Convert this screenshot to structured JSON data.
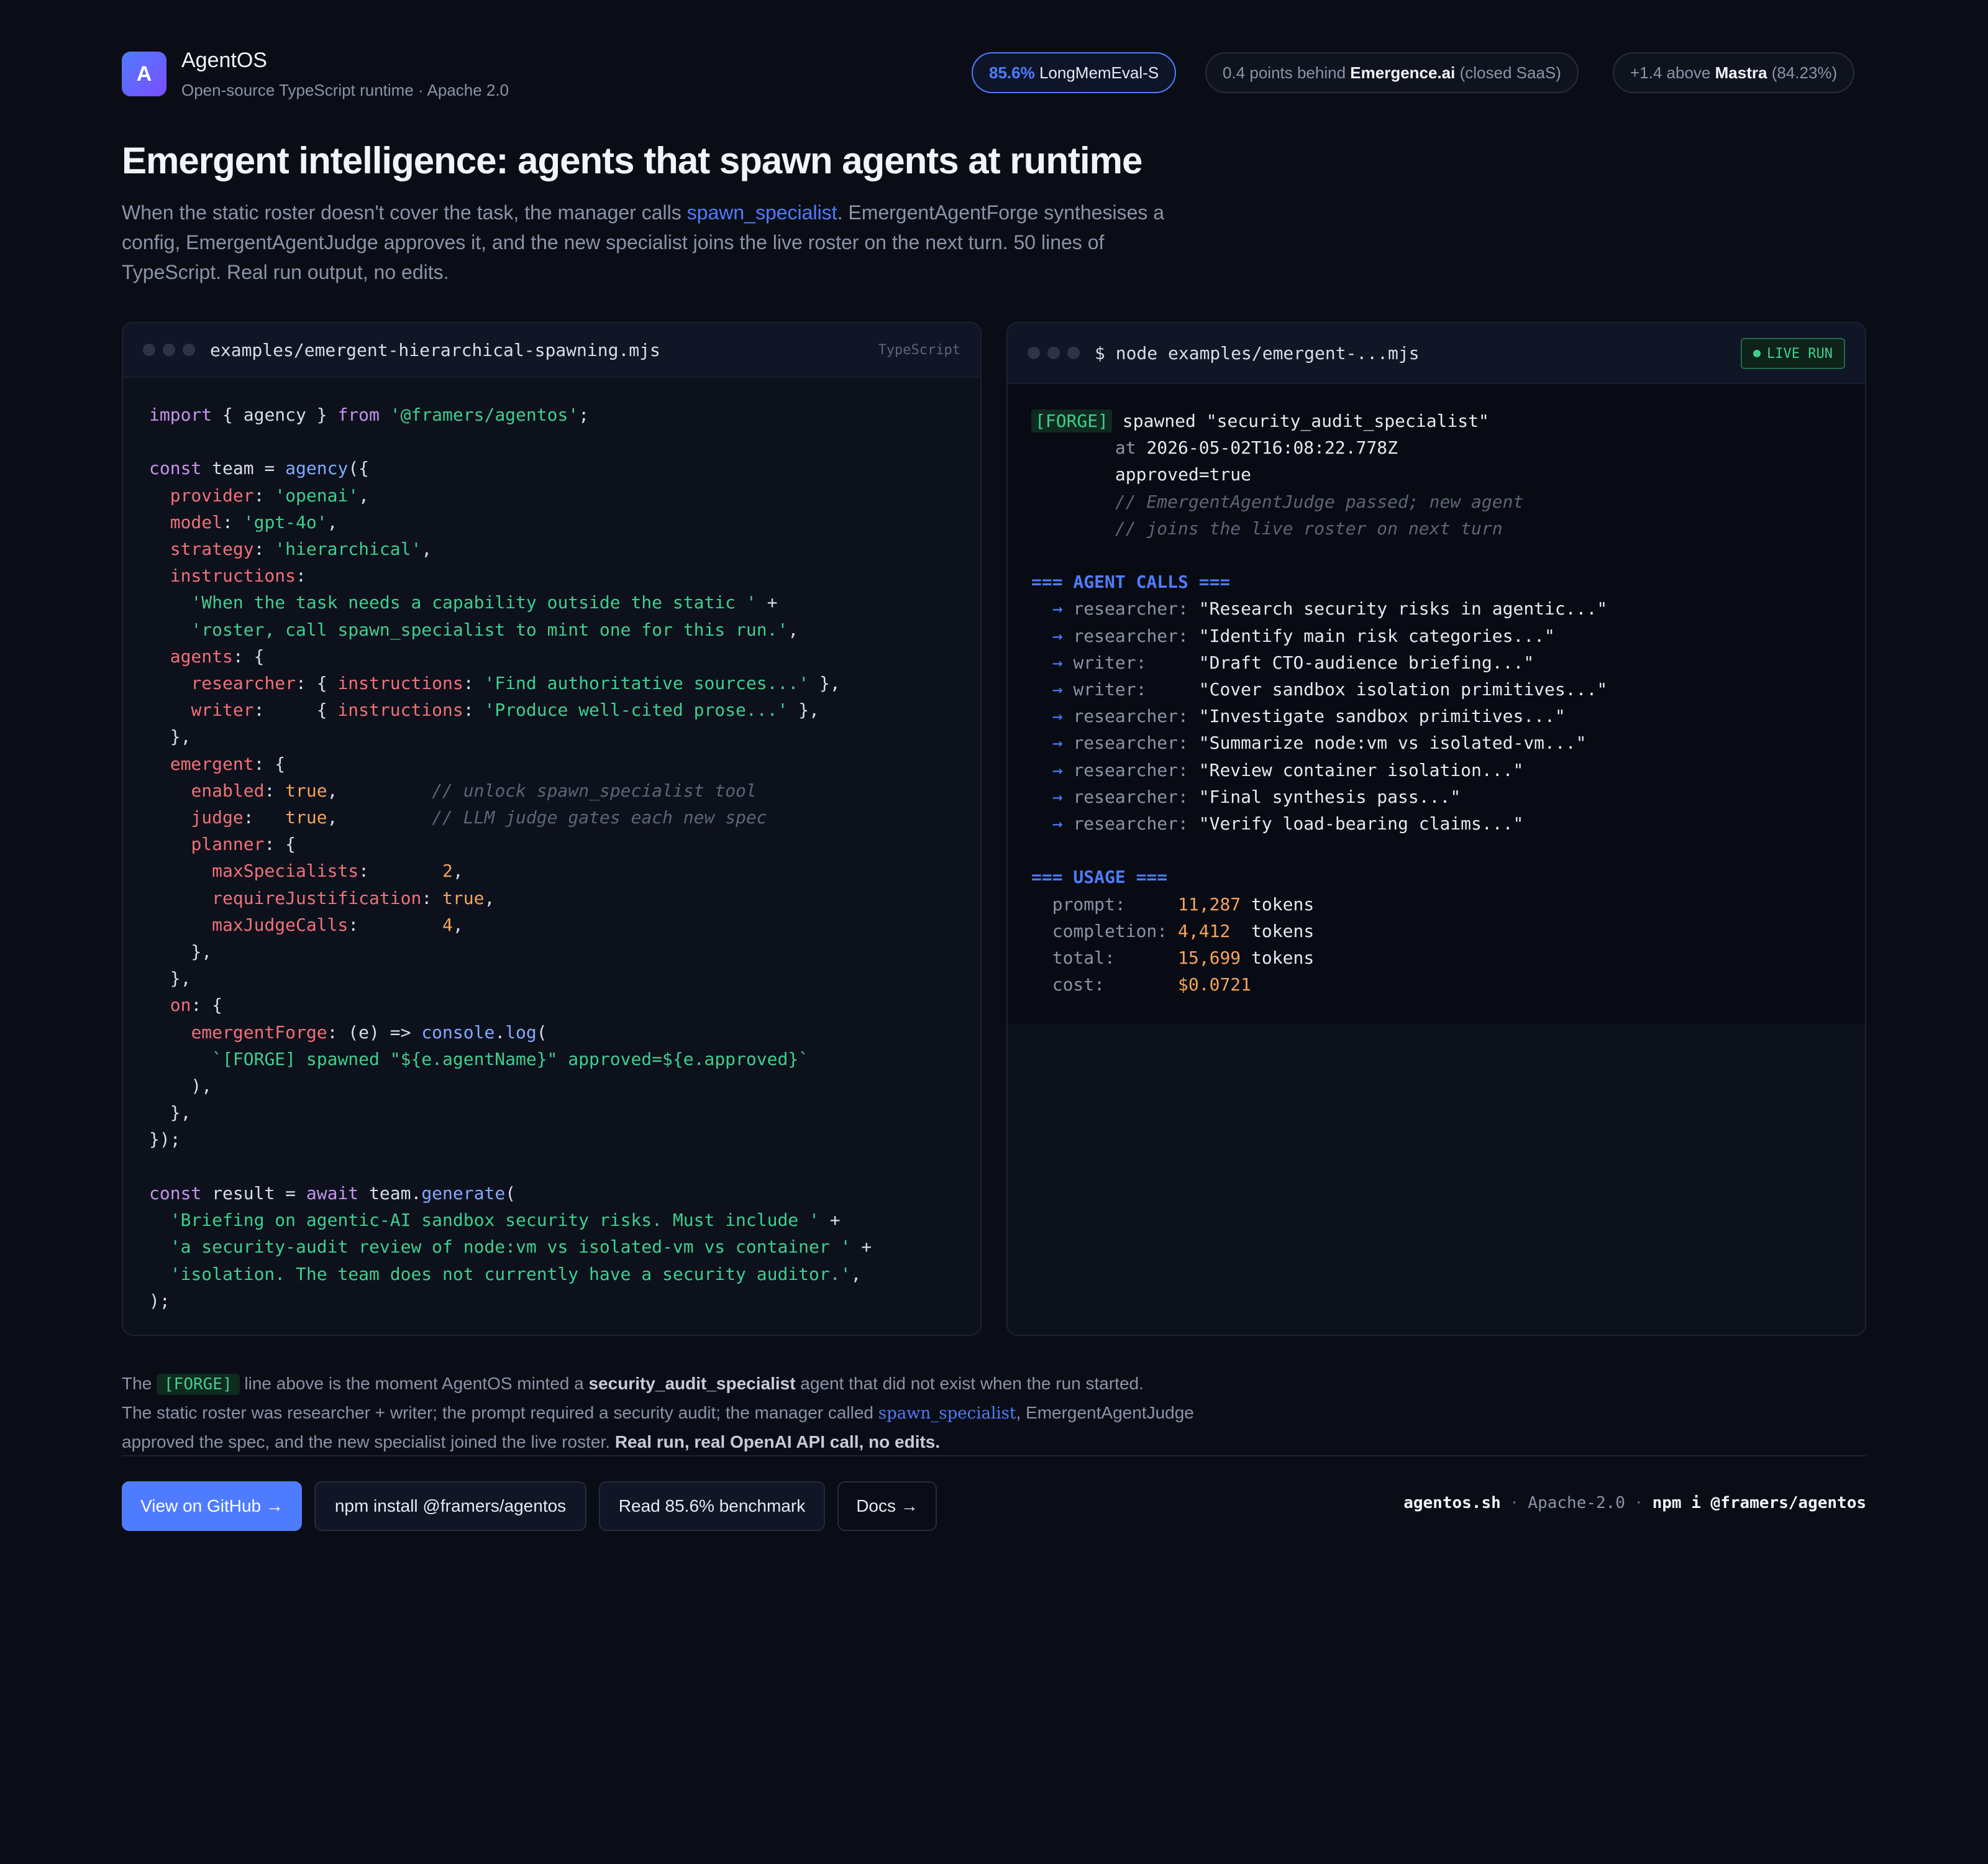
{
  "brand": {
    "logo_letter": "A",
    "name": "AgentOS",
    "subtitle": "Open-source TypeScript runtime · Apache 2.0"
  },
  "badges": {
    "score_value": "85.6%",
    "score_label": "LongMemEval-S",
    "behind_prefix": "0.4 points behind",
    "behind_name": "Emergence.ai",
    "behind_suffix": "(closed SaaS)",
    "above_prefix": "+1.4 above",
    "above_name": "Mastra",
    "above_suffix": "(84.23%)"
  },
  "hero": {
    "title": "Emergent intelligence: agents that spawn agents at runtime",
    "lede_before": "When the static roster doesn't cover the task, the manager calls ",
    "lede_link": "spawn_specialist",
    "lede_after": ". EmergentAgentForge synthesises a config, EmergentAgentJudge approves it, and the new specialist joins the live roster on the next turn. 50 lines of TypeScript. Real run output, no edits."
  },
  "code_panel": {
    "filename": "examples/emergent-hierarchical-spawning.mjs",
    "language": "TypeScript"
  },
  "terminal_panel": {
    "command": "$ node examples/emergent-...mjs",
    "live_label": "LIVE RUN",
    "forge_tag": "[FORGE]",
    "forge_text": " spawned \"security_audit_specialist\"",
    "at_label": "at",
    "timestamp": "2026-05-02T16:08:22.778Z",
    "approved": "approved=true",
    "comment_1": "// EmergentAgentJudge passed; new agent",
    "comment_2": "// joins the live roster on next turn",
    "calls_header": "=== AGENT CALLS ===",
    "calls": [
      {
        "agent": "researcher:",
        "text": "\"Research security risks in agentic...\""
      },
      {
        "agent": "researcher:",
        "text": "\"Identify main risk categories...\""
      },
      {
        "agent": "writer:    ",
        "text": "\"Draft CTO-audience briefing...\""
      },
      {
        "agent": "writer:    ",
        "text": "\"Cover sandbox isolation primitives...\""
      },
      {
        "agent": "researcher:",
        "text": "\"Investigate sandbox primitives...\""
      },
      {
        "agent": "researcher:",
        "text": "\"Summarize node:vm vs isolated-vm...\""
      },
      {
        "agent": "researcher:",
        "text": "\"Review container isolation...\""
      },
      {
        "agent": "researcher:",
        "text": "\"Final synthesis pass...\""
      },
      {
        "agent": "researcher:",
        "text": "\"Verify load-bearing claims...\""
      }
    ],
    "usage_header": "=== USAGE ===",
    "usage": {
      "prompt_label": "prompt:    ",
      "prompt_value": "11,287",
      "completion_label": "completion:",
      "completion_value": "4,412 ",
      "total_label": "total:     ",
      "total_value": "15,699",
      "cost_label": "cost:      ",
      "cost_value": "$0.0721",
      "unit": "tokens"
    }
  },
  "note": {
    "p1_before": "The ",
    "p1_tag": "[FORGE]",
    "p1_mid": " line above is the moment AgentOS minted a ",
    "p1_bold": "security_audit_specialist",
    "p1_after": " agent that did not exist when the run started.",
    "p2_before": "The static roster was researcher + writer; the prompt required a security audit; the manager called ",
    "p2_link": "spawn_specialist",
    "p2_after": ", EmergentAgentJudge approved the spec, and the new specialist joined the live roster. ",
    "p2_bold": "Real run, real OpenAI API call, no edits."
  },
  "actions": {
    "github": "View on GitHub →",
    "npm": "npm install @framers/agentos",
    "benchmark": "Read 85.6% benchmark",
    "docs": "Docs →"
  },
  "footer": {
    "site": "agentos.sh",
    "sep": "·",
    "license": "Apache-2.0",
    "install": "npm i @framers/agentos"
  },
  "colors": {
    "background": "#0a0d16",
    "accent": "#4f7cff",
    "green": "#3ecf8e",
    "number": "#f5a35c"
  }
}
